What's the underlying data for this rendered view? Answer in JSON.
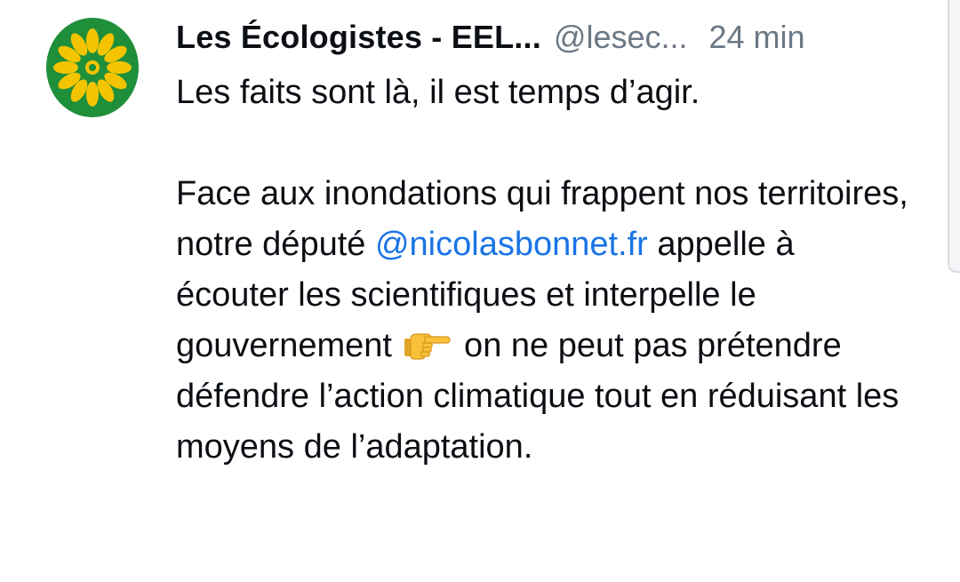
{
  "post": {
    "author": {
      "display_name": "Les Écologistes - EEL...",
      "handle": "@lesec...",
      "avatar_icon": "sunflower-logo",
      "avatar_bg": "#1f8f3a",
      "avatar_petal": "#f5c400"
    },
    "timestamp": "24 min",
    "body": {
      "line1": "Les faits sont là, il est temps d’agir.",
      "p2_part1": "Face aux inondations qui frappent nos territoires, notre député ",
      "mention": "@nicolasbonnet.fr",
      "p2_part2": " appelle à écouter les scientifiques et interpelle le gouvernement",
      "emoji": "pointing-right-hand-emoji",
      "p2_part3": " on ne peut pas prétendre défendre l’action climatique tout en réduisant les moyens de l’adaptation."
    },
    "colors": {
      "mention": "#1a74e6",
      "meta_text": "#6b7885",
      "text": "#0b0f14"
    }
  }
}
